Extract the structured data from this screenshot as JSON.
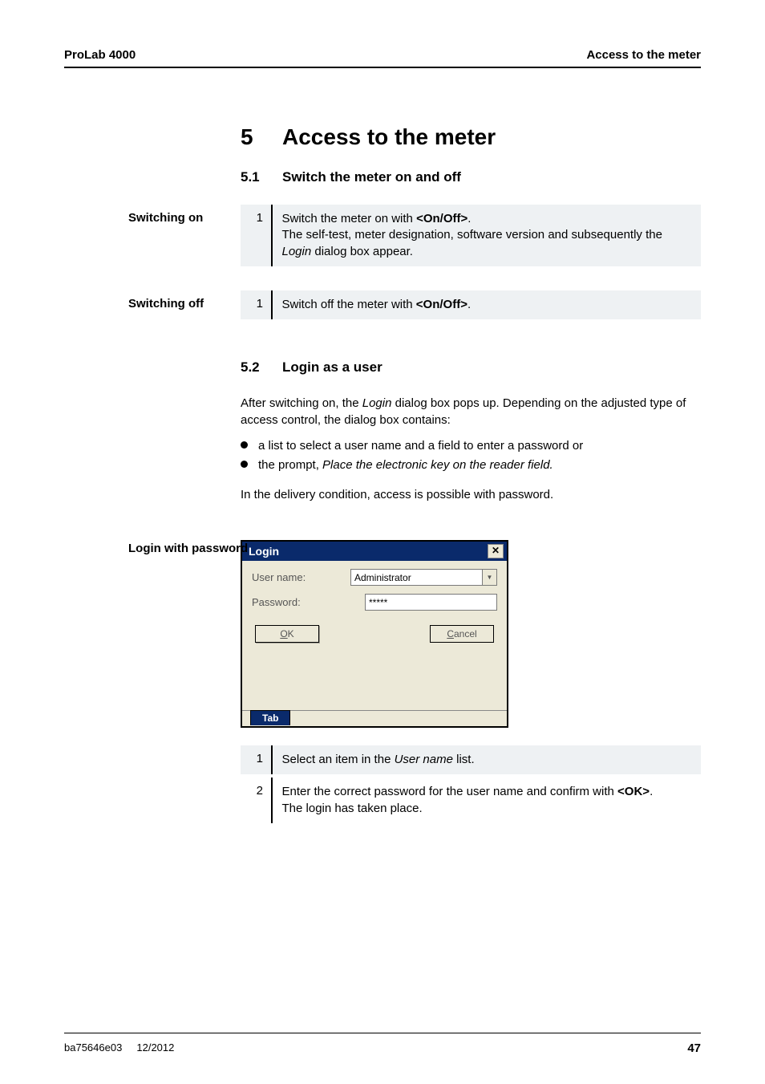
{
  "header": {
    "left": "ProLab 4000",
    "right": "Access to the meter"
  },
  "chapter": {
    "number": "5",
    "title": "Access to the meter"
  },
  "section51": {
    "number": "5.1",
    "title": "Switch the meter on and off"
  },
  "switching_on": {
    "label": "Switching on",
    "step_num": "1",
    "text_pre": "Switch the meter on with ",
    "text_bold": "<On/Off>",
    "text_post": ".",
    "line2_pre": "The self-test, meter designation, software version and subsequently the ",
    "line2_em": "Login",
    "line2_post": " dialog box appear."
  },
  "switching_off": {
    "label": "Switching off",
    "step_num": "1",
    "text_pre": "Switch off the meter with ",
    "text_bold": "<On/Off>",
    "text_post": "."
  },
  "section52": {
    "number": "5.2",
    "title": "Login as a user"
  },
  "para1_pre": "After switching on, the ",
  "para1_em": "Login",
  "para1_post": " dialog box pops up. Depending on the adjusted type of access control, the dialog box contains:",
  "bullet1": "a list to select a user name and a field to enter a password or",
  "bullet2_pre": "the prompt, ",
  "bullet2_em": "Place the electronic key on the reader field.",
  "para2": "In the delivery condition, access is possible with password.",
  "login_with_password_label": "Login with password",
  "login_dialog": {
    "title": "Login",
    "close": "✕",
    "username_label": "User name:",
    "username_value": "Administrator",
    "password_label": "Password:",
    "password_value": "*****",
    "ok_char": "O",
    "ok_rest": "K",
    "cancel_char": "C",
    "cancel_rest": "ancel",
    "tab": "Tab"
  },
  "steps_after_dialog": {
    "s1_num": "1",
    "s1_pre": "Select an item in the ",
    "s1_em": "User name",
    "s1_post": " list.",
    "s2_num": "2",
    "s2_line1_pre": "Enter the correct password for the user name and confirm with ",
    "s2_line1_bold": "<OK>",
    "s2_line1_post": ".",
    "s2_line2": "The login has taken place."
  },
  "footer": {
    "doc": "ba75646e03",
    "date": "12/2012",
    "page": "47"
  }
}
